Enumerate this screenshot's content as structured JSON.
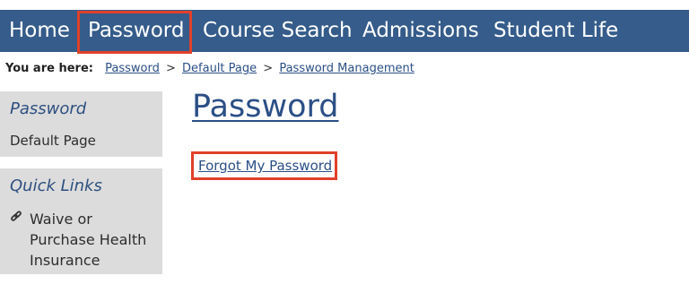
{
  "nav": {
    "items": [
      {
        "label": "Home"
      },
      {
        "label": "Password"
      },
      {
        "label": "Course Search"
      },
      {
        "label": "Admissions"
      },
      {
        "label": "Student Life"
      }
    ],
    "active_item": "Password",
    "bg_color": "#355c8a",
    "highlight_color": "#e0412a"
  },
  "breadcrumb": {
    "prefix": "You are here:",
    "links": [
      "Password",
      "Default Page",
      "Password Management"
    ],
    "separator": ">"
  },
  "sidebar": {
    "section1": {
      "heading": "Password",
      "links": [
        "Default Page"
      ]
    },
    "section2": {
      "heading": "Quick Links",
      "icon": "link-icon",
      "links": [
        "Waive or Purchase Health Insurance"
      ]
    }
  },
  "main": {
    "title": "Password",
    "link": "Forgot My Password"
  }
}
